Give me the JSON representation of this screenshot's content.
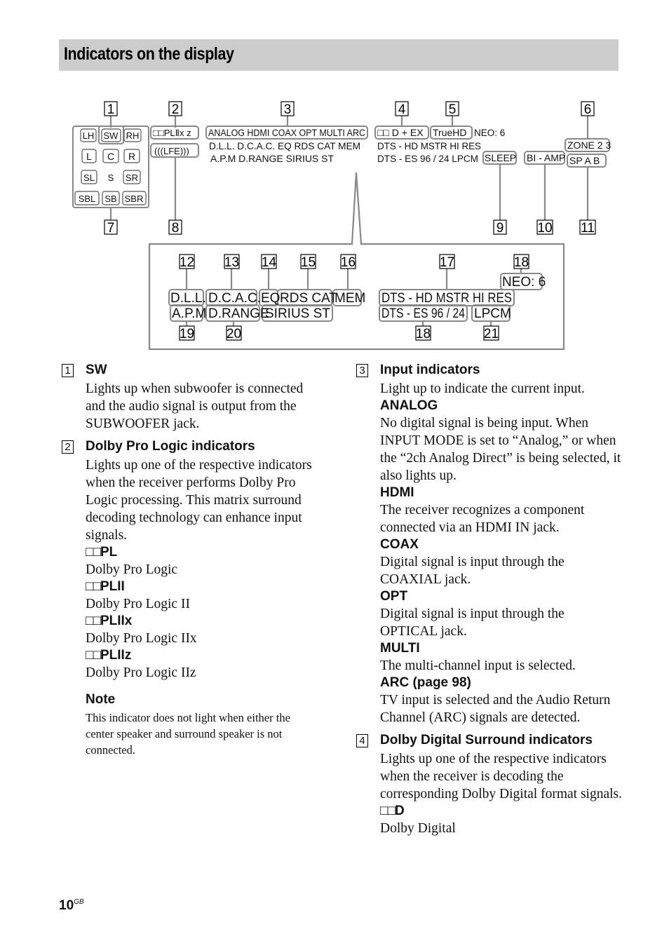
{
  "page": {
    "title": "Indicators on the display",
    "page_number": "10",
    "page_suffix": "GB"
  },
  "diagram": {
    "callouts_top": [
      "1",
      "2",
      "3",
      "4",
      "5",
      "6"
    ],
    "callouts_bottom": [
      "7",
      "8",
      "9",
      "10",
      "11"
    ],
    "speaker_grid": {
      "row1": [
        "LH",
        "SW",
        "RH"
      ],
      "row2": [
        "L",
        "C",
        "R"
      ],
      "row3": [
        "SL",
        "S",
        "SR"
      ],
      "row4": [
        "SBL",
        "SB",
        "SBR"
      ]
    },
    "dolby_pl": "□□PLⅡx z",
    "lfe": "(((LFE)))",
    "input_row": "ANALOG HDMI COAX OPT MULTI ARC",
    "row2_text": "D.L.L.  D.C.A.C.  EQ RDS CAT MEM",
    "row3_text": "A.P.M D.RANGE  SIRIUS  ST",
    "dolby_d": "□□ D + EX",
    "truehd": "TrueHD",
    "neo6": "NEO: 6",
    "dts_hd": "DTS - HD  MSTR  HI RES",
    "dts_es": "DTS - ES 96 / 24   LPCM",
    "sleep": "SLEEP",
    "biamp": "BI - AMP",
    "zone": "ZONE 2 3",
    "sp_ab": "SP  A  B",
    "detail": {
      "callouts_top": [
        "12",
        "13",
        "14",
        "15",
        "16",
        "17",
        "18"
      ],
      "callouts_bottom": [
        "19",
        "20",
        "18",
        "21"
      ],
      "dll": "D.L.L.",
      "dcac": "D.C.A.C.",
      "eq": "EQ",
      "rds_cat": "RDS  CAT",
      "mem": "MEM",
      "apm": "A.P.M",
      "drange": "D.RANGE",
      "sirius_st": "SIRIUS  ST",
      "neo6": "NEO: 6",
      "dts_hd": "DTS - HD  MSTR  HI RES",
      "dts_es": "DTS - ES 96 / 24",
      "lpcm": "LPCM"
    }
  },
  "sections": {
    "s1": {
      "num": "1",
      "title": "SW",
      "body": "Lights up when subwoofer is connected and the audio signal is output from the SUBWOOFER jack."
    },
    "s2": {
      "num": "2",
      "title": "Dolby Pro Logic indicators",
      "body": "Lights up one of the respective indicators when the receiver performs Dolby Pro Logic processing. This matrix surround decoding technology can enhance input signals.",
      "entries": [
        {
          "label": "PL",
          "desc": "Dolby Pro Logic"
        },
        {
          "label": "PLII",
          "desc": "Dolby Pro Logic II"
        },
        {
          "label": "PLIIx",
          "desc": "Dolby Pro Logic IIx"
        },
        {
          "label": "PLIIz",
          "desc": "Dolby Pro Logic IIz"
        }
      ],
      "note_title": "Note",
      "note_body": "This indicator does not light when either the center speaker and surround speaker is not connected."
    },
    "s3": {
      "num": "3",
      "title": "Input indicators",
      "body": "Light up to indicate the current input.",
      "entries": [
        {
          "label": "ANALOG",
          "desc": "No digital signal is being input. When INPUT MODE is set to “Analog,” or when the “2ch Analog Direct” is being selected, it also lights up."
        },
        {
          "label": "HDMI",
          "desc": "The receiver recognizes a component connected via an HDMI IN jack."
        },
        {
          "label": "COAX",
          "desc": "Digital signal is input through the COAXIAL jack."
        },
        {
          "label": "OPT",
          "desc": "Digital signal is input through the OPTICAL jack."
        },
        {
          "label": "MULTI",
          "desc": "The multi-channel input is selected."
        },
        {
          "label": "ARC (page 98)",
          "desc": "TV input is selected and the Audio Return Channel (ARC) signals are detected."
        }
      ]
    },
    "s4": {
      "num": "4",
      "title": "Dolby Digital Surround indicators",
      "body": "Lights up one of the respective indicators when the receiver is decoding the corresponding Dolby Digital format signals.",
      "entries": [
        {
          "label": "D",
          "desc": "Dolby Digital"
        }
      ]
    }
  },
  "dolby_symbol": "□□"
}
